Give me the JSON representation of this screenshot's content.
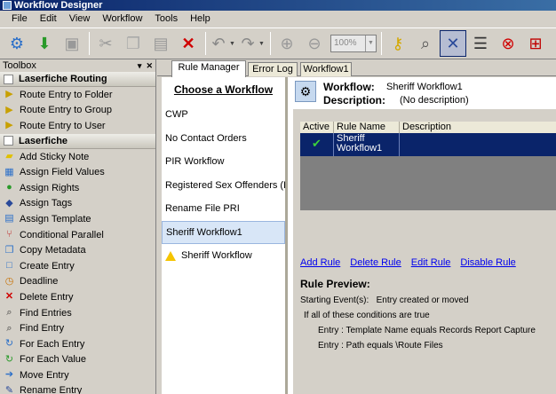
{
  "window": {
    "title": "Workflow Designer"
  },
  "menu": [
    "File",
    "Edit",
    "View",
    "Workflow",
    "Tools",
    "Help"
  ],
  "toolbar": {
    "zoom_value": "100%",
    "icons": [
      "new-workflow-icon",
      "publish-icon",
      "delete-workflow-icon",
      "cut-icon",
      "copy-icon",
      "paste-icon",
      "delete-icon",
      "undo-icon",
      "redo-icon",
      "zoom-in-icon",
      "zoom-out-icon",
      "key-icon",
      "find-icon",
      "rule-manager-icon",
      "list-icon",
      "stop-icon",
      "expand-icon"
    ]
  },
  "toolbox": {
    "title": "Toolbox",
    "controls": [
      "▾",
      "✕"
    ],
    "sections": [
      {
        "label": "Laserfiche Routing",
        "items": [
          {
            "label": "Route Entry to Folder",
            "icon": "route-folder-icon"
          },
          {
            "label": "Route Entry to Group",
            "icon": "route-group-icon"
          },
          {
            "label": "Route Entry to User",
            "icon": "route-user-icon"
          }
        ]
      },
      {
        "label": "Laserfiche",
        "items": [
          {
            "label": "Add Sticky Note",
            "icon": "sticky-note-icon"
          },
          {
            "label": "Assign Field Values",
            "icon": "field-values-icon"
          },
          {
            "label": "Assign Rights",
            "icon": "rights-icon"
          },
          {
            "label": "Assign Tags",
            "icon": "tags-icon"
          },
          {
            "label": "Assign Template",
            "icon": "template-icon"
          },
          {
            "label": "Conditional Parallel",
            "icon": "parallel-icon"
          },
          {
            "label": "Copy Metadata",
            "icon": "copy-metadata-icon"
          },
          {
            "label": "Create Entry",
            "icon": "create-entry-icon"
          },
          {
            "label": "Deadline",
            "icon": "deadline-icon"
          },
          {
            "label": "Delete Entry",
            "icon": "delete-entry-icon"
          },
          {
            "label": "Find Entries",
            "icon": "find-entries-icon"
          },
          {
            "label": "Find Entry",
            "icon": "find-entry-icon"
          },
          {
            "label": "For Each Entry",
            "icon": "for-each-entry-icon"
          },
          {
            "label": "For Each Value",
            "icon": "for-each-value-icon"
          },
          {
            "label": "Move Entry",
            "icon": "move-entry-icon"
          },
          {
            "label": "Rename Entry",
            "icon": "rename-entry-icon"
          }
        ]
      }
    ]
  },
  "tabs": [
    "Rule Manager",
    "Error Log",
    "Workflow1"
  ],
  "workflow_list": {
    "title": "Choose a Workflow",
    "items": [
      "CWP",
      "No Contact Orders",
      "PIR Workflow",
      "Registered Sex Offenders (R...",
      "Rename File PRI",
      "Sheriff Workflow1",
      "Sheriff Workflow"
    ],
    "selected": "Sheriff Workflow1"
  },
  "details": {
    "workflow_label": "Workflow:",
    "workflow_value": "Sheriff Workflow1",
    "description_label": "Description:",
    "description_value": "(No description)"
  },
  "rules_grid": {
    "columns": [
      "Active",
      "Rule Name",
      "Description"
    ],
    "rows": [
      {
        "active": "✔",
        "name_line1": "Sheriff",
        "name_line2": "Workflow1",
        "description": ""
      }
    ]
  },
  "rule_links": [
    "Add Rule",
    "Delete Rule",
    "Edit Rule",
    "Disable Rule"
  ],
  "preview": {
    "title": "Rule Preview:",
    "starting_label": "Starting Event(s):",
    "starting_value": "Entry created or moved",
    "conditions_intro": "If all of these conditions are true",
    "conditions": [
      "Entry : Template Name equals Records Report Capture",
      "Entry : Path equals \\Route Files"
    ]
  }
}
